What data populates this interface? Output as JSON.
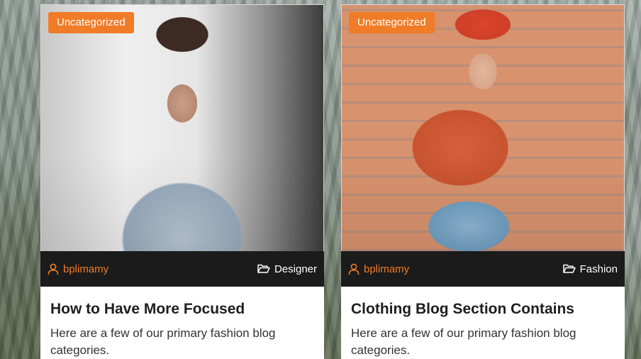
{
  "colors": {
    "accent": "#f07c28",
    "meta_bar": "#1b1b1b"
  },
  "cards": [
    {
      "badge": "Uncategorized",
      "author": "bplimamy",
      "category": "Designer",
      "title": "How to Have More Focused",
      "excerpt": "Here are a few of our primary fashion blog categories."
    },
    {
      "badge": "Uncategorized",
      "author": "bplimamy",
      "category": "Fashion",
      "title": "Clothing Blog Section Contains",
      "excerpt": "Here are a few of our primary fashion blog categories."
    }
  ],
  "icons": {
    "author": "user-icon",
    "category": "folder-open-icon"
  }
}
